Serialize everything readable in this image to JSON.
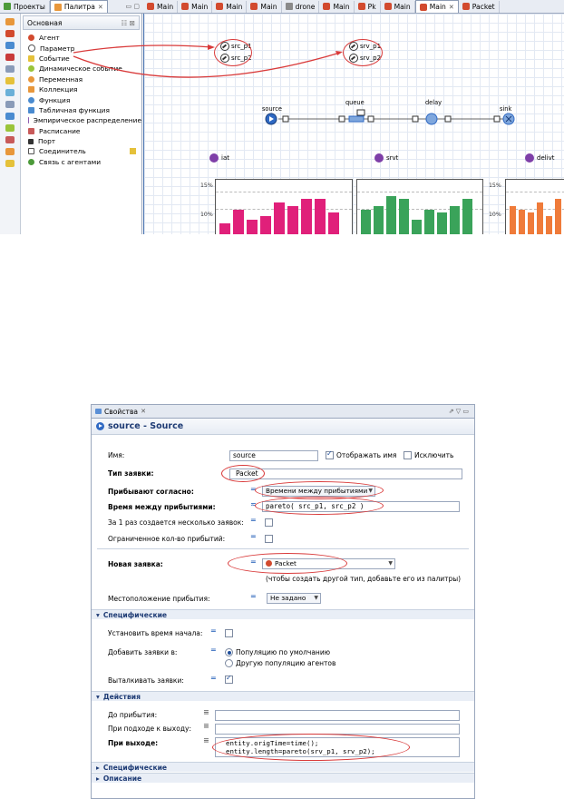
{
  "top_tabs": {
    "left": [
      {
        "label": "Проекты",
        "icon": "projects-icon"
      },
      {
        "label": "Палитра",
        "icon": "palette-icon",
        "active": true
      }
    ],
    "editor": [
      "Main",
      "Main",
      "Main",
      "Main",
      "drone",
      "Main",
      "Pk",
      "Main",
      "Main",
      "Packet"
    ]
  },
  "palette": {
    "header": "Основная",
    "items": [
      {
        "label": "Агент",
        "icon": "agent-icon",
        "color": "#d24a2e"
      },
      {
        "label": "Параметр",
        "icon": "parameter-icon",
        "color": "#555555"
      },
      {
        "label": "Событие",
        "icon": "event-icon",
        "color": "#e5c13a"
      },
      {
        "label": "Динамическое событие",
        "icon": "dynamic-event-icon",
        "color": "#9ac43a"
      },
      {
        "label": "Переменная",
        "icon": "variable-icon",
        "color": "#e8973b"
      },
      {
        "label": "Коллекция",
        "icon": "collection-icon",
        "color": "#e8973b"
      },
      {
        "label": "Функция",
        "icon": "function-icon",
        "color": "#4a8bd0"
      },
      {
        "label": "Табличная функция",
        "icon": "table-function-icon",
        "color": "#4a8bd0"
      },
      {
        "label": "Эмпирическое распределение",
        "icon": "empirical-distribution-icon",
        "color": "#8d5db0"
      },
      {
        "label": "Расписание",
        "icon": "schedule-icon",
        "color": "#c85a5a"
      },
      {
        "label": "Порт",
        "icon": "port-icon",
        "color": "#333333"
      },
      {
        "label": "Соединитель",
        "icon": "connector-icon",
        "color": "#555555"
      },
      {
        "label": "Связь с агентами",
        "icon": "agent-link-icon",
        "color": "#4c9a3a"
      }
    ]
  },
  "canvas": {
    "params_left": [
      "src_p1",
      "src_p2"
    ],
    "params_right": [
      "srv_p1",
      "srv_p2"
    ],
    "blocks": [
      "source",
      "queue",
      "delay",
      "sink"
    ],
    "histograms": [
      {
        "label": "iat",
        "color": "#e0207a",
        "bars": [
          0.06,
          0.1,
          0.07,
          0.08,
          0.12,
          0.11,
          0.13,
          0.13,
          0.09
        ]
      },
      {
        "label": "srvt",
        "color": "#3aa35a",
        "bars": [
          0.1,
          0.11,
          0.14,
          0.13,
          0.07,
          0.1,
          0.09,
          0.11,
          0.13
        ]
      },
      {
        "label": "delivt",
        "color": "#ef7b3a",
        "bars": [
          0.11,
          0.1,
          0.09,
          0.12,
          0.08,
          0.13
        ]
      }
    ],
    "yticks": [
      "15%",
      "10%"
    ]
  },
  "props": {
    "tab": "Свойства",
    "title": "source - Source",
    "name_label": "Имя:",
    "name_value": "source",
    "show_name_label": "Отображать имя",
    "exclude_label": "Исключить",
    "entity_type_label": "Тип заявки:",
    "entity_type_value": "Packet",
    "arrivals_label": "Прибывают согласно:",
    "arrivals_value": "Времени между прибытиями",
    "interarrival_label": "Время между прибытиями:",
    "interarrival_value": "pareto( src_p1, src_p2 )",
    "multiple_label": "За 1 раз создается несколько заявок:",
    "limited_label": "Ограниченное кол-во прибытий:",
    "new_entity_label": "Новая заявка:",
    "new_entity_value": "Packet",
    "new_entity_hint": "(чтобы создать другой тип, добавьте его из палитры)",
    "location_label": "Местоположение прибытия:",
    "location_value": "Не задано",
    "section_specific": "Специфические",
    "start_time_label": "Установить время начала:",
    "add_to_label": "Добавить заявки в:",
    "radio_default": "Популяцию по умолчанию",
    "radio_other": "Другую популяцию агентов",
    "push_label": "Выталкивать заявки:",
    "section_actions": "Действия",
    "before_label": "До прибытия:",
    "exit_approach_label": "При подходе к выходу:",
    "on_exit_label": "При выходе:",
    "on_exit_code_1": "entity.origTime=time();",
    "on_exit_code_2": "entity.length=pareto(srv_p1, srv_p2);",
    "section_specific2": "Специфические",
    "section_description": "Описание"
  }
}
